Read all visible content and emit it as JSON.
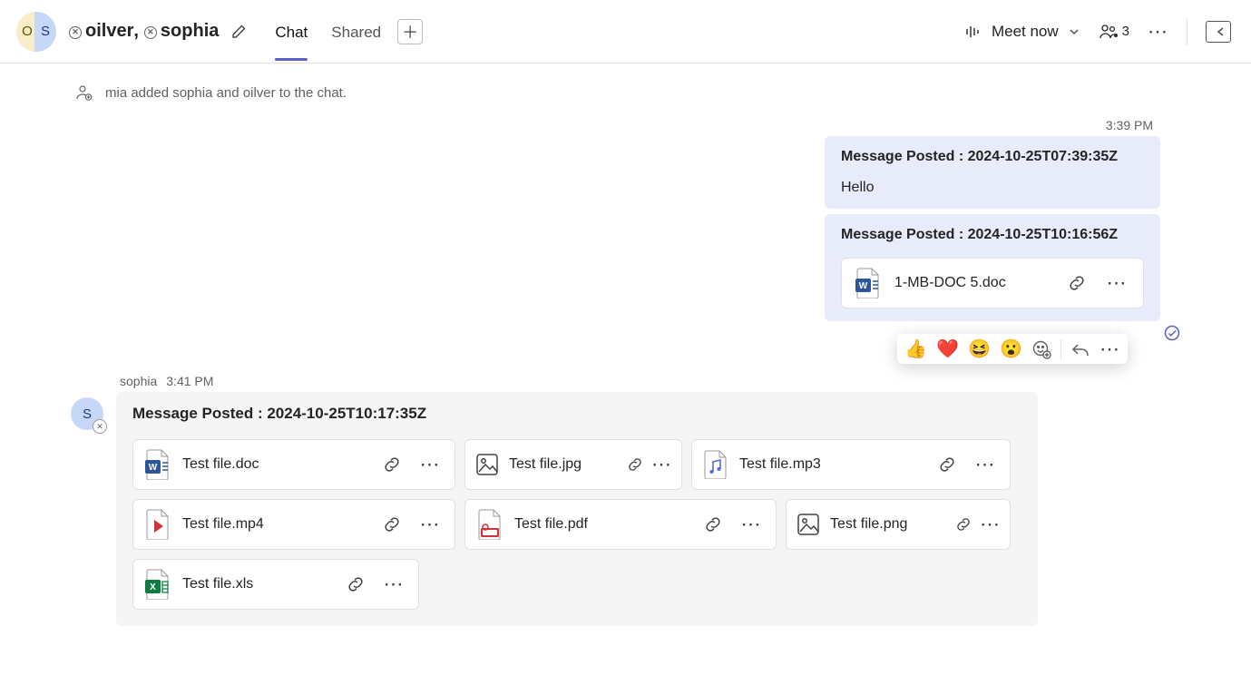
{
  "header": {
    "avatar_left_initial": "O",
    "avatar_right_initial": "S",
    "title_parts": {
      "name1": "oilver",
      "name2": "sophia"
    },
    "tabs": {
      "chat": "Chat",
      "shared": "Shared"
    },
    "meet_now": "Meet now",
    "people_count": "3"
  },
  "system_event": "mia added sophia and oilver to the chat.",
  "right_timestamp": "3:39 PM",
  "my_messages": [
    {
      "header": "Message Posted : 2024-10-25T07:39:35Z",
      "body": "Hello"
    },
    {
      "header": "Message Posted : 2024-10-25T10:16:56Z",
      "attachment": {
        "name": "1-MB-DOC 5.doc",
        "type": "word"
      }
    }
  ],
  "reactions": {
    "e1": "👍",
    "e2": "❤️",
    "e3": "😆",
    "e4": "😮"
  },
  "incoming": {
    "sender": "sophia",
    "time": "3:41 PM",
    "avatar_initial": "S",
    "header": "Message Posted : 2024-10-25T10:17:35Z",
    "files": [
      {
        "name": "Test file.doc",
        "type": "word"
      },
      {
        "name": "Test file.jpg",
        "type": "image"
      },
      {
        "name": "Test file.mp3",
        "type": "audio"
      },
      {
        "name": "Test file.mp4",
        "type": "video"
      },
      {
        "name": "Test file.pdf",
        "type": "pdf"
      },
      {
        "name": "Test file.png",
        "type": "image"
      },
      {
        "name": "Test file.xls",
        "type": "excel"
      }
    ]
  }
}
